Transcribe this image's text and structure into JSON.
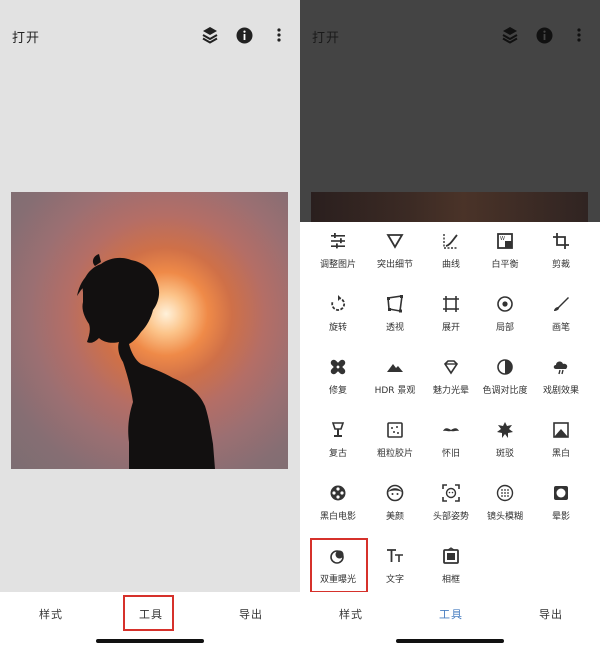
{
  "left_screen": {
    "title": "打开",
    "top_icons": [
      "layers-icon",
      "info-icon",
      "more-vertical-icon"
    ],
    "nav": {
      "styles": "样式",
      "tools": "工具",
      "export": "导出"
    }
  },
  "right_screen": {
    "title": "打开",
    "top_icons": [
      "layers-icon",
      "info-icon",
      "more-vertical-icon"
    ],
    "tools": [
      {
        "label": "调整图片",
        "icon": "tune-icon"
      },
      {
        "label": "突出细节",
        "icon": "details-icon"
      },
      {
        "label": "曲线",
        "icon": "curves-icon"
      },
      {
        "label": "白平衡",
        "icon": "white-balance-icon"
      },
      {
        "label": "剪裁",
        "icon": "crop-icon"
      },
      {
        "label": "旋转",
        "icon": "rotate-icon"
      },
      {
        "label": "透视",
        "icon": "perspective-icon"
      },
      {
        "label": "展开",
        "icon": "expand-icon"
      },
      {
        "label": "局部",
        "icon": "selective-icon"
      },
      {
        "label": "画笔",
        "icon": "brush-icon"
      },
      {
        "label": "修复",
        "icon": "healing-icon"
      },
      {
        "label": "HDR 景观",
        "icon": "hdr-icon"
      },
      {
        "label": "魅力光晕",
        "icon": "glamour-glow-icon"
      },
      {
        "label": "色调对比度",
        "icon": "tonal-contrast-icon"
      },
      {
        "label": "戏剧效果",
        "icon": "drama-icon"
      },
      {
        "label": "复古",
        "icon": "vintage-icon"
      },
      {
        "label": "粗粒胶片",
        "icon": "grainy-film-icon"
      },
      {
        "label": "怀旧",
        "icon": "retrolux-icon"
      },
      {
        "label": "斑驳",
        "icon": "grunge-icon"
      },
      {
        "label": "黑白",
        "icon": "black-white-icon"
      },
      {
        "label": "黑白电影",
        "icon": "noir-icon"
      },
      {
        "label": "美颜",
        "icon": "face-enhance-icon"
      },
      {
        "label": "头部姿势",
        "icon": "head-pose-icon"
      },
      {
        "label": "镜头模糊",
        "icon": "lens-blur-icon"
      },
      {
        "label": "晕影",
        "icon": "vignette-icon"
      },
      {
        "label": "双重曝光",
        "icon": "double-exposure-icon"
      },
      {
        "label": "文字",
        "icon": "text-icon"
      },
      {
        "label": "相框",
        "icon": "frames-icon"
      }
    ],
    "nav": {
      "styles": "样式",
      "tools": "工具",
      "export": "导出"
    }
  },
  "colors": {
    "highlight": "#d6312b",
    "active_tab": "#4a7fc1"
  }
}
